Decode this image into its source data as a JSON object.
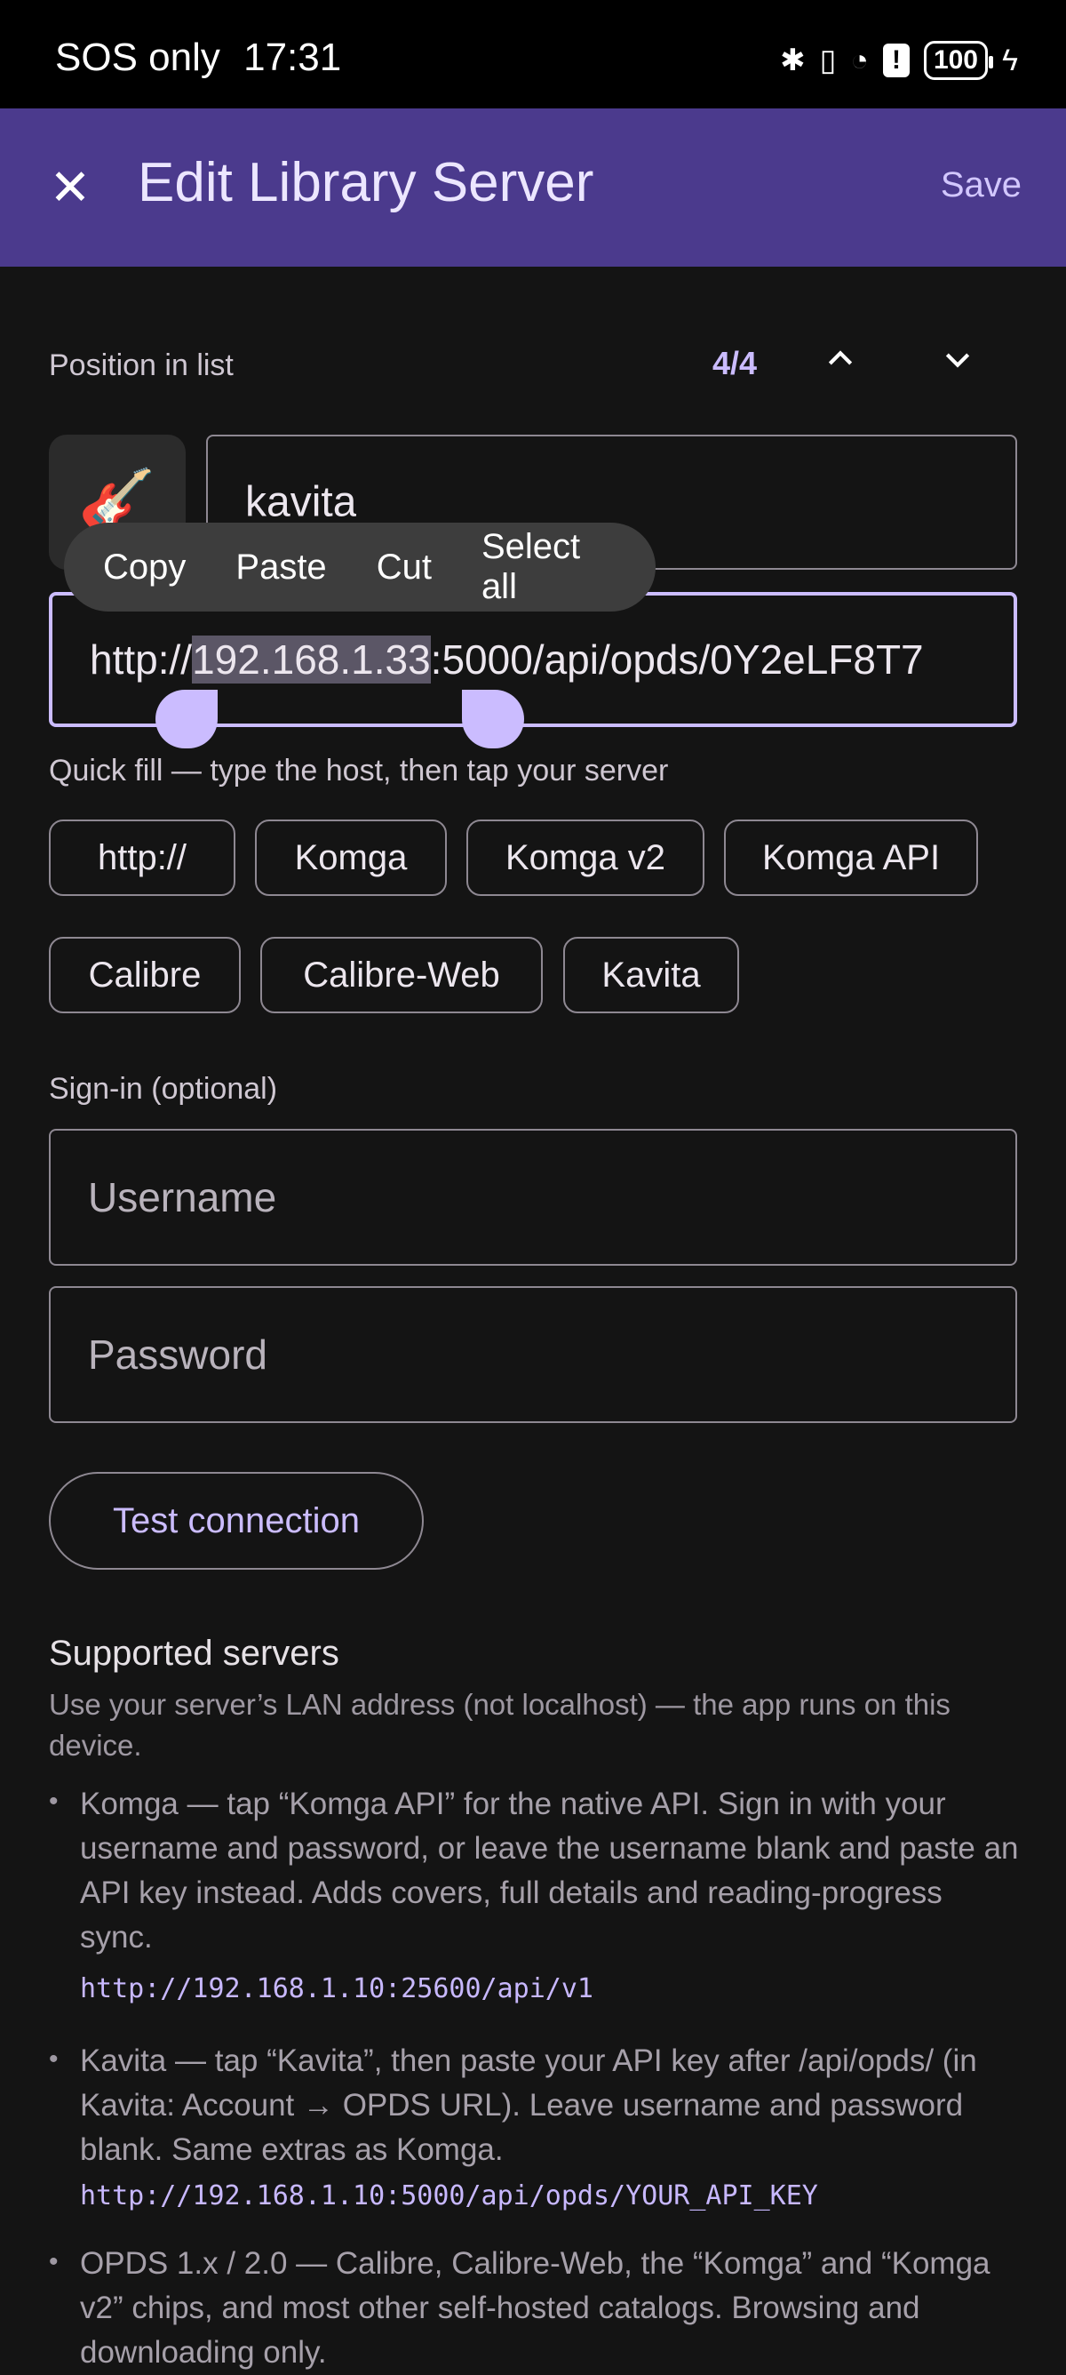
{
  "status_bar": {
    "carrier": "SOS only",
    "time": "17:31",
    "battery": "100"
  },
  "app_bar": {
    "title": "Edit Library Server",
    "save_label": "Save"
  },
  "position": {
    "label": "Position in list",
    "count": "4/4"
  },
  "server": {
    "icon": "guitar-emoji",
    "emoji": "🎸",
    "name": "kavita"
  },
  "url": {
    "before": "http://",
    "selected": "192.168.1.33",
    "after": ":5000/api/opds/0Y2eLF8T7"
  },
  "context_menu": {
    "copy": "Copy",
    "paste": "Paste",
    "cut": "Cut",
    "select_all": "Select all"
  },
  "quick_fill": {
    "label": "Quick fill — type the host, then tap your server",
    "chips": [
      "http://",
      "Komga",
      "Komga v2",
      "Komga API",
      "Calibre",
      "Calibre-Web",
      "Kavita"
    ]
  },
  "sign_in": {
    "label": "Sign-in (optional)",
    "username_placeholder": "Username",
    "password_placeholder": "Password"
  },
  "test_button": "Test connection",
  "supported": {
    "title": "Supported servers",
    "intro": "Use your server’s LAN address (not localhost) — the app runs on this device.",
    "items": [
      {
        "text": "Komga — tap “Komga API” for the native API. Sign in with your username and password, or leave the username blank and paste an API key instead. Adds covers, full details and reading-progress sync.",
        "code": "http://192.168.1.10:25600/api/v1"
      },
      {
        "text": "Kavita — tap “Kavita”, then paste your API key after /api/opds/ (in Kavita: Account → OPDS URL). Leave username and password blank. Same extras as Komga.",
        "code": "http://192.168.1.10:5000/api/opds/YOUR_API_KEY"
      },
      {
        "text": "OPDS 1.x / 2.0 — Calibre, Calibre-Web, the “Komga” and “Komga v2” chips, and most other self-hosted catalogs. Browsing and downloading only."
      }
    ]
  },
  "colors": {
    "app_bar": "#4b3a8d",
    "accent": "#cbbcff",
    "background": "#141414"
  }
}
